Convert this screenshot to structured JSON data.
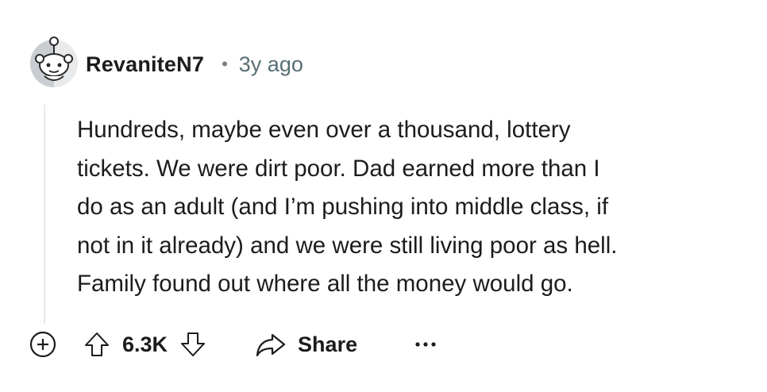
{
  "comment": {
    "username": "RevaniteN7",
    "separator": "•",
    "timestamp": "3y ago",
    "body_lines": [
      "Hundreds, maybe even over a thousand, lottery",
      "tickets. We were dirt poor. Dad earned more than I",
      "do as an adult (and I’m pushing into middle class, if",
      "not in it already) and we were still living poor as hell.",
      "Family found out where all the money would go."
    ],
    "score": "6.3K",
    "share_label": "Share"
  },
  "icons": {
    "avatar": "snoo-avatar-icon",
    "expand": "plus-circle-icon",
    "upvote": "upvote-arrow-icon",
    "downvote": "downvote-arrow-icon",
    "share": "share-arrow-icon",
    "more": "more-dots-icon"
  },
  "colors": {
    "text": "#1c1c1c",
    "meta": "#576f76",
    "thread_line": "#e5ebee"
  }
}
